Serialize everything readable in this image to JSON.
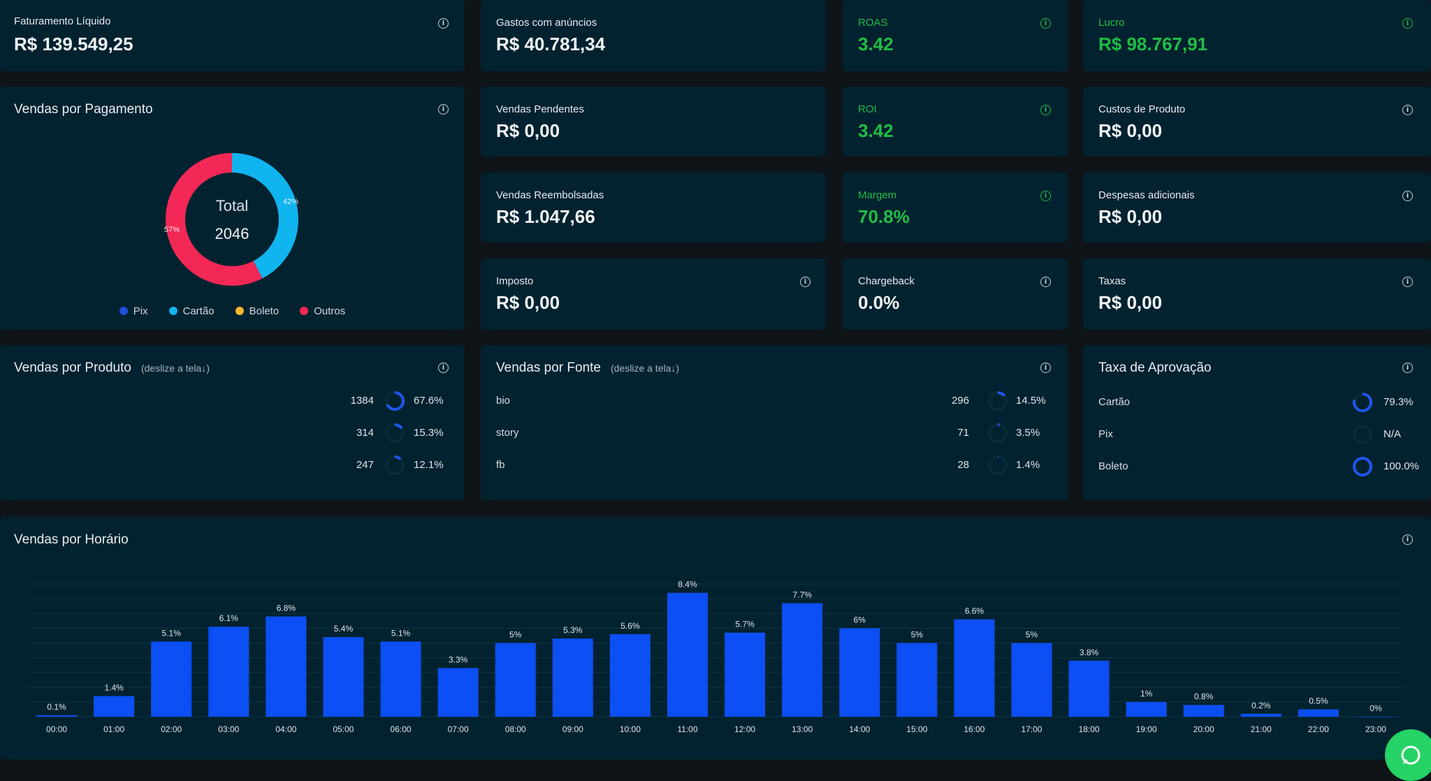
{
  "kpis": {
    "faturamento": {
      "label": "Faturamento Líquido",
      "value": "R$ 139.549,25"
    },
    "gastos": {
      "label": "Gastos com anúncios",
      "value": "R$ 40.781,34"
    },
    "roas": {
      "label": "ROAS",
      "value": "3.42"
    },
    "lucro": {
      "label": "Lucro",
      "value": "R$ 98.767,91"
    },
    "pendentes": {
      "label": "Vendas Pendentes",
      "value": "R$ 0,00"
    },
    "roi": {
      "label": "ROI",
      "value": "3.42"
    },
    "custos": {
      "label": "Custos de Produto",
      "value": "R$ 0,00"
    },
    "reembolsadas": {
      "label": "Vendas Reembolsadas",
      "value": "R$ 1.047,66"
    },
    "margem": {
      "label": "Margem",
      "value": "70.8%"
    },
    "despesas": {
      "label": "Despesas adicionais",
      "value": "R$ 0,00"
    },
    "imposto": {
      "label": "Imposto",
      "value": "R$ 0,00"
    },
    "chargeback": {
      "label": "Chargeback",
      "value": "0.0%"
    },
    "taxas": {
      "label": "Taxas",
      "value": "R$ 0,00"
    }
  },
  "pagamento": {
    "title": "Vendas por Pagamento",
    "total_label": "Total",
    "total_value": "2046",
    "slices": [
      {
        "name": "Cartão",
        "pct": 42,
        "label": "42%",
        "color": "#10b4ee"
      },
      {
        "name": "Outros",
        "pct": 57,
        "label": "57%",
        "color": "#f42856"
      }
    ],
    "legend": [
      {
        "name": "Pix",
        "color": "#1e4fe0"
      },
      {
        "name": "Cartão",
        "color": "#10b4ee"
      },
      {
        "name": "Boleto",
        "color": "#f5b731"
      },
      {
        "name": "Outros",
        "color": "#f42856"
      }
    ]
  },
  "produto": {
    "title": "Vendas por Produto",
    "hint": "(deslize a tela",
    "rows": [
      {
        "count": "1384",
        "pct": "67.6%",
        "fraction": 0.676
      },
      {
        "count": "314",
        "pct": "15.3%",
        "fraction": 0.153
      },
      {
        "count": "247",
        "pct": "12.1%",
        "fraction": 0.121
      }
    ]
  },
  "fonte": {
    "title": "Vendas por Fonte",
    "hint": "(deslize a tela",
    "rows": [
      {
        "name": "bio",
        "count": "296",
        "pct": "14.5%",
        "fraction": 0.145
      },
      {
        "name": "story",
        "count": "71",
        "pct": "3.5%",
        "fraction": 0.035
      },
      {
        "name": "fb",
        "count": "28",
        "pct": "1.4%",
        "fraction": 0.014
      }
    ]
  },
  "aprovacao": {
    "title": "Taxa de Aprovação",
    "rows": [
      {
        "name": "Cartão",
        "pct": "79.3%",
        "fraction": 0.793
      },
      {
        "name": "Pix",
        "pct": "N/A",
        "fraction": 0
      },
      {
        "name": "Boleto",
        "pct": "100.0%",
        "fraction": 1.0
      }
    ]
  },
  "horario": {
    "title": "Vendas por Horário"
  },
  "chart_data": {
    "type": "bar",
    "categories": [
      "00:00",
      "01:00",
      "02:00",
      "03:00",
      "04:00",
      "05:00",
      "06:00",
      "07:00",
      "08:00",
      "09:00",
      "10:00",
      "11:00",
      "12:00",
      "13:00",
      "14:00",
      "15:00",
      "16:00",
      "17:00",
      "18:00",
      "19:00",
      "20:00",
      "21:00",
      "22:00",
      "23:00"
    ],
    "values": [
      0.1,
      1.4,
      5.1,
      6.1,
      6.8,
      5.4,
      5.1,
      3.3,
      5,
      5.3,
      5.6,
      8.4,
      5.7,
      7.7,
      6,
      5,
      6.6,
      5,
      3.8,
      1,
      0.8,
      0.2,
      0.5,
      0
    ],
    "labels": [
      "0.1%",
      "1.4%",
      "5.1%",
      "6.1%",
      "6.8%",
      "5.4%",
      "5.1%",
      "3.3%",
      "5%",
      "5.3%",
      "5.6%",
      "8.4%",
      "5.7%",
      "7.7%",
      "6%",
      "5%",
      "6.6%",
      "5%",
      "3.8%",
      "1%",
      "0.8%",
      "0.2%",
      "0.5%",
      "0%"
    ],
    "title": "Vendas por Horário",
    "color": "#0b4ff5",
    "grid": true
  }
}
